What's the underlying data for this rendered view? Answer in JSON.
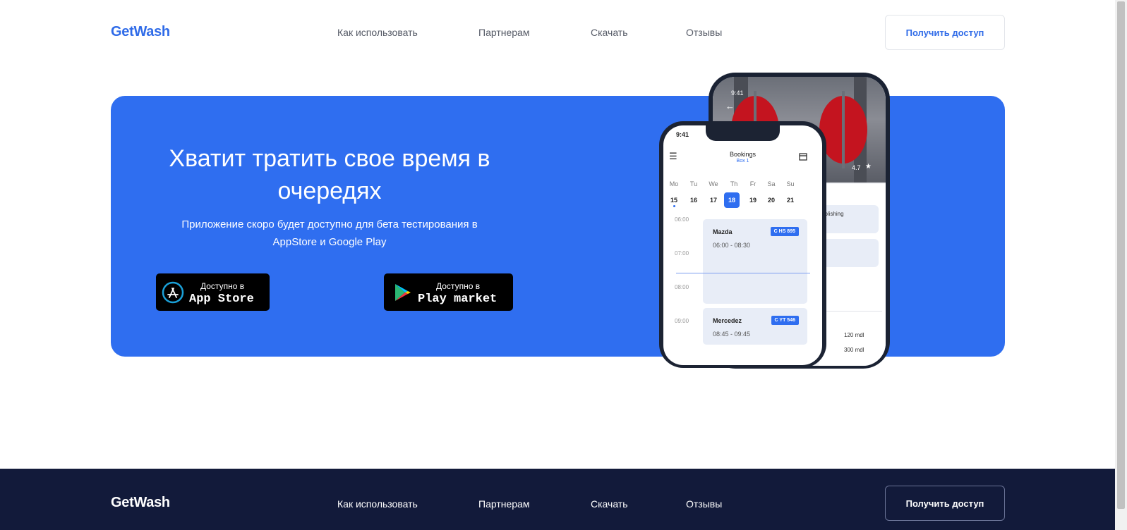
{
  "brand": {
    "name": "GetWash",
    "accent": "#2f6ef0",
    "footer_bg": "#121a3a"
  },
  "nav": {
    "items": [
      "Как использовать",
      "Партнерам",
      "Скачать",
      "Отзывы"
    ],
    "cta": "Получить доступ"
  },
  "hero": {
    "title": "Хватит тратить свое время в очередях",
    "subtitle": "Приложение скоро будет доступно для бета тестирования в AppStore и Google Play",
    "app_store": {
      "small": "Доступно в",
      "big": "App Store",
      "icon": "app-store-icon"
    },
    "play_market": {
      "small": "Доступно в",
      "big": "Play market",
      "icon": "google-play-icon"
    }
  },
  "phone_front": {
    "time": "9:41",
    "title": "Bookings",
    "subtitle": "Box 1",
    "weekdays": [
      "Mo",
      "Tu",
      "We",
      "Th",
      "Fr",
      "Sa",
      "Su"
    ],
    "days": [
      "15",
      "16",
      "17",
      "18",
      "19",
      "20",
      "21"
    ],
    "selected_day": "18",
    "times": [
      "06:00",
      "07:00",
      "08:00",
      "09:00"
    ],
    "bookings": [
      {
        "car": "Mazda",
        "plate": "C HS 895",
        "time": "06:00 - 08:30"
      },
      {
        "car": "Mercedez",
        "plate": "C YT 546",
        "time": "08:45 - 09:45"
      }
    ]
  },
  "phone_back": {
    "time": "9:41",
    "rating": "4.7",
    "service": "polishing",
    "prices": [
      "120 mdl",
      "300 mdl"
    ]
  },
  "footer": {
    "brand": "GetWash",
    "nav": [
      "Как использовать",
      "Партнерам",
      "Скачать",
      "Отзывы"
    ],
    "cta": "Получить доступ"
  }
}
